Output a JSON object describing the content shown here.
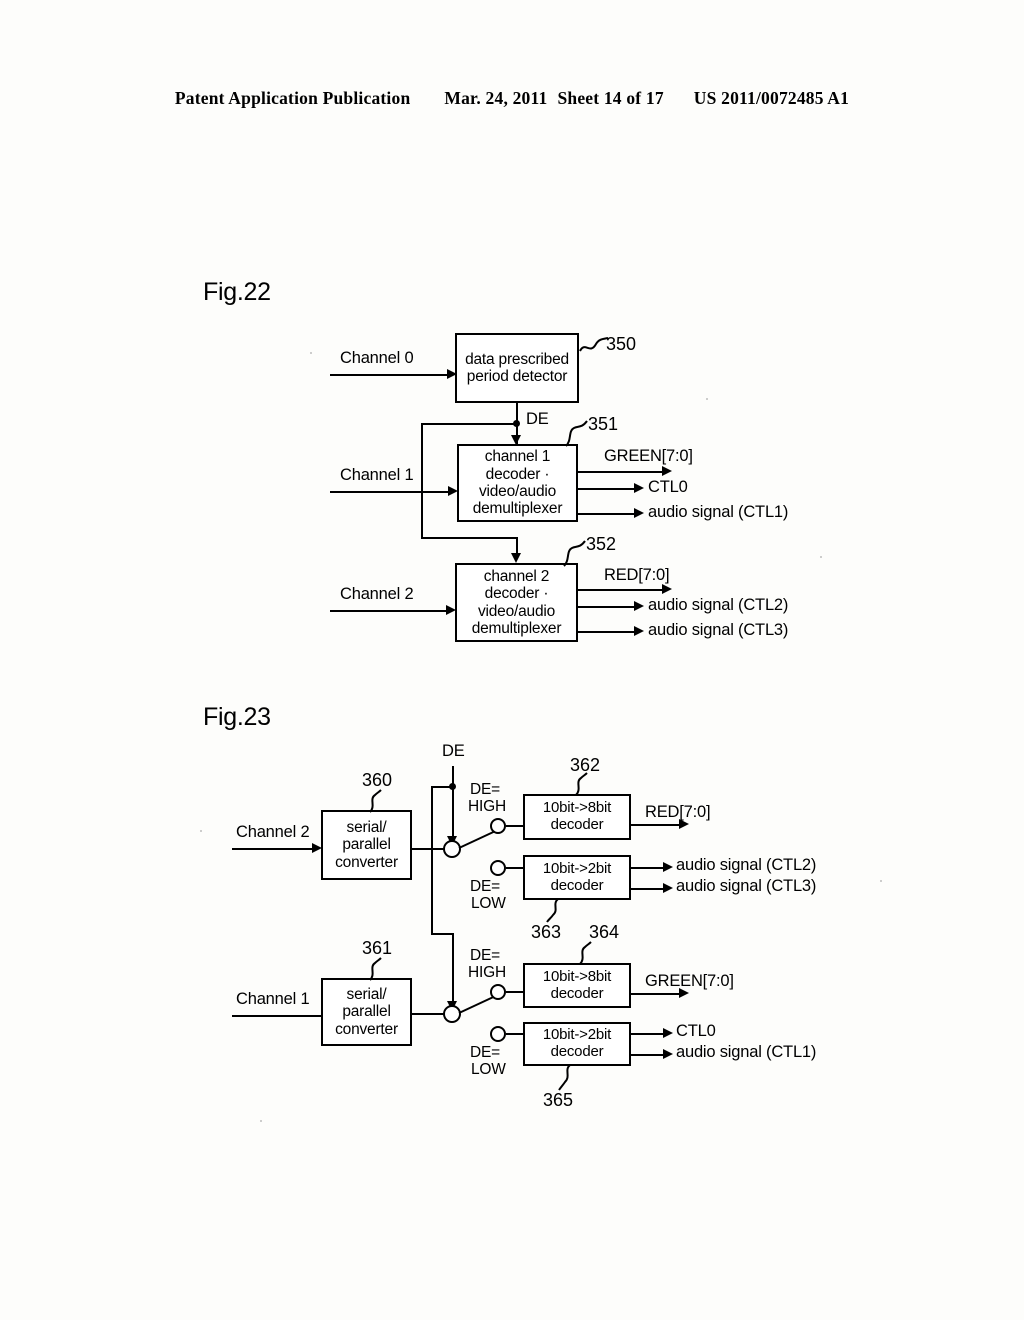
{
  "header": {
    "left": "Patent Application Publication",
    "date": "Mar. 24, 2011",
    "sheet": "Sheet 14 of 17",
    "docnum": "US 2011/0072485 A1"
  },
  "figures": [
    {
      "id": "fig22",
      "label": "Fig.22",
      "inputs": [
        {
          "name": "channel-0-input",
          "text": "Channel 0"
        },
        {
          "name": "channel-1-input",
          "text": "Channel 1"
        },
        {
          "name": "channel-2-input",
          "text": "Channel 2"
        }
      ],
      "blocks": [
        {
          "name": "data-prescribed-period-detector",
          "ref": "350",
          "lines": [
            "data prescribed",
            "period detector"
          ]
        },
        {
          "name": "channel-1-decoder-demultiplexer",
          "ref": "351",
          "lines": [
            "channel 1",
            "decoder ·",
            "video/audio",
            "demultiplexer"
          ]
        },
        {
          "name": "channel-2-decoder-demultiplexer",
          "ref": "352",
          "lines": [
            "channel 2",
            "decoder ·",
            "video/audio",
            "demultiplexer"
          ]
        }
      ],
      "signals": {
        "de": "DE",
        "outputs_351": [
          "GREEN[7:0]",
          "CTL0",
          "audio signal (CTL1)"
        ],
        "outputs_352": [
          "RED[7:0]",
          "audio signal (CTL2)",
          "audio signal (CTL3)"
        ]
      }
    },
    {
      "id": "fig23",
      "label": "Fig.23",
      "de_label": "DE",
      "inputs": [
        {
          "name": "channel-2-input",
          "text": "Channel 2"
        },
        {
          "name": "channel-1-input",
          "text": "Channel 1"
        }
      ],
      "blocks": [
        {
          "name": "serial-parallel-converter-ch2",
          "ref": "360",
          "lines": [
            "serial/",
            "parallel",
            "converter"
          ]
        },
        {
          "name": "serial-parallel-converter-ch1",
          "ref": "361",
          "lines": [
            "serial/",
            "parallel",
            "converter"
          ]
        },
        {
          "name": "decoder-10bit-8bit-red",
          "ref": "362",
          "lines": [
            "10bit->8bit",
            "decoder"
          ]
        },
        {
          "name": "decoder-10bit-2bit-audio23",
          "ref": "363",
          "lines": [
            "10bit->2bit",
            "decoder"
          ]
        },
        {
          "name": "decoder-10bit-8bit-green",
          "ref": "364",
          "lines": [
            "10bit->8bit",
            "decoder"
          ]
        },
        {
          "name": "decoder-10bit-2bit-ctl01",
          "ref": "365",
          "lines": [
            "10bit->2bit",
            "decoder"
          ]
        }
      ],
      "switch_labels": [
        {
          "name": "switch-label-high-upper",
          "l1": "DE=",
          "l2": "HIGH"
        },
        {
          "name": "switch-label-low-upper",
          "l1": "DE=",
          "l2": "LOW"
        },
        {
          "name": "switch-label-high-lower",
          "l1": "DE=",
          "l2": "HIGH"
        },
        {
          "name": "switch-label-low-lower",
          "l1": "DE=",
          "l2": "LOW"
        }
      ],
      "outputs": {
        "red": "RED[7:0]",
        "audio2": "audio signal (CTL2)",
        "audio3": "audio signal (CTL3)",
        "green": "GREEN[7:0]",
        "ctl0": "CTL0",
        "audio1": "audio signal (CTL1)"
      }
    }
  ]
}
